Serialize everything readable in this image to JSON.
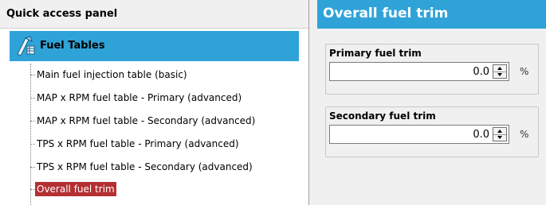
{
  "quick_access": {
    "title": "Quick access panel",
    "group": {
      "label": "Fuel Tables",
      "icon": "fuel-table-icon"
    },
    "items": [
      {
        "label": "Main fuel injection table (basic)",
        "selected": false
      },
      {
        "label": "MAP x RPM fuel table - Primary (advanced)",
        "selected": false
      },
      {
        "label": "MAP x RPM fuel table - Secondary (advanced)",
        "selected": false
      },
      {
        "label": "TPS x RPM fuel table - Primary (advanced)",
        "selected": false
      },
      {
        "label": "TPS x RPM fuel table - Secondary (advanced)",
        "selected": false
      },
      {
        "label": "Overall fuel trim",
        "selected": true
      }
    ]
  },
  "detail": {
    "title": "Overall fuel trim",
    "fields": [
      {
        "label": "Primary fuel trim",
        "value": "0.0",
        "unit": "%"
      },
      {
        "label": "Secondary fuel trim",
        "value": "0.0",
        "unit": "%"
      }
    ]
  },
  "colors": {
    "header_blue": "#2fa3d8",
    "selected_red": "#b42f32"
  }
}
